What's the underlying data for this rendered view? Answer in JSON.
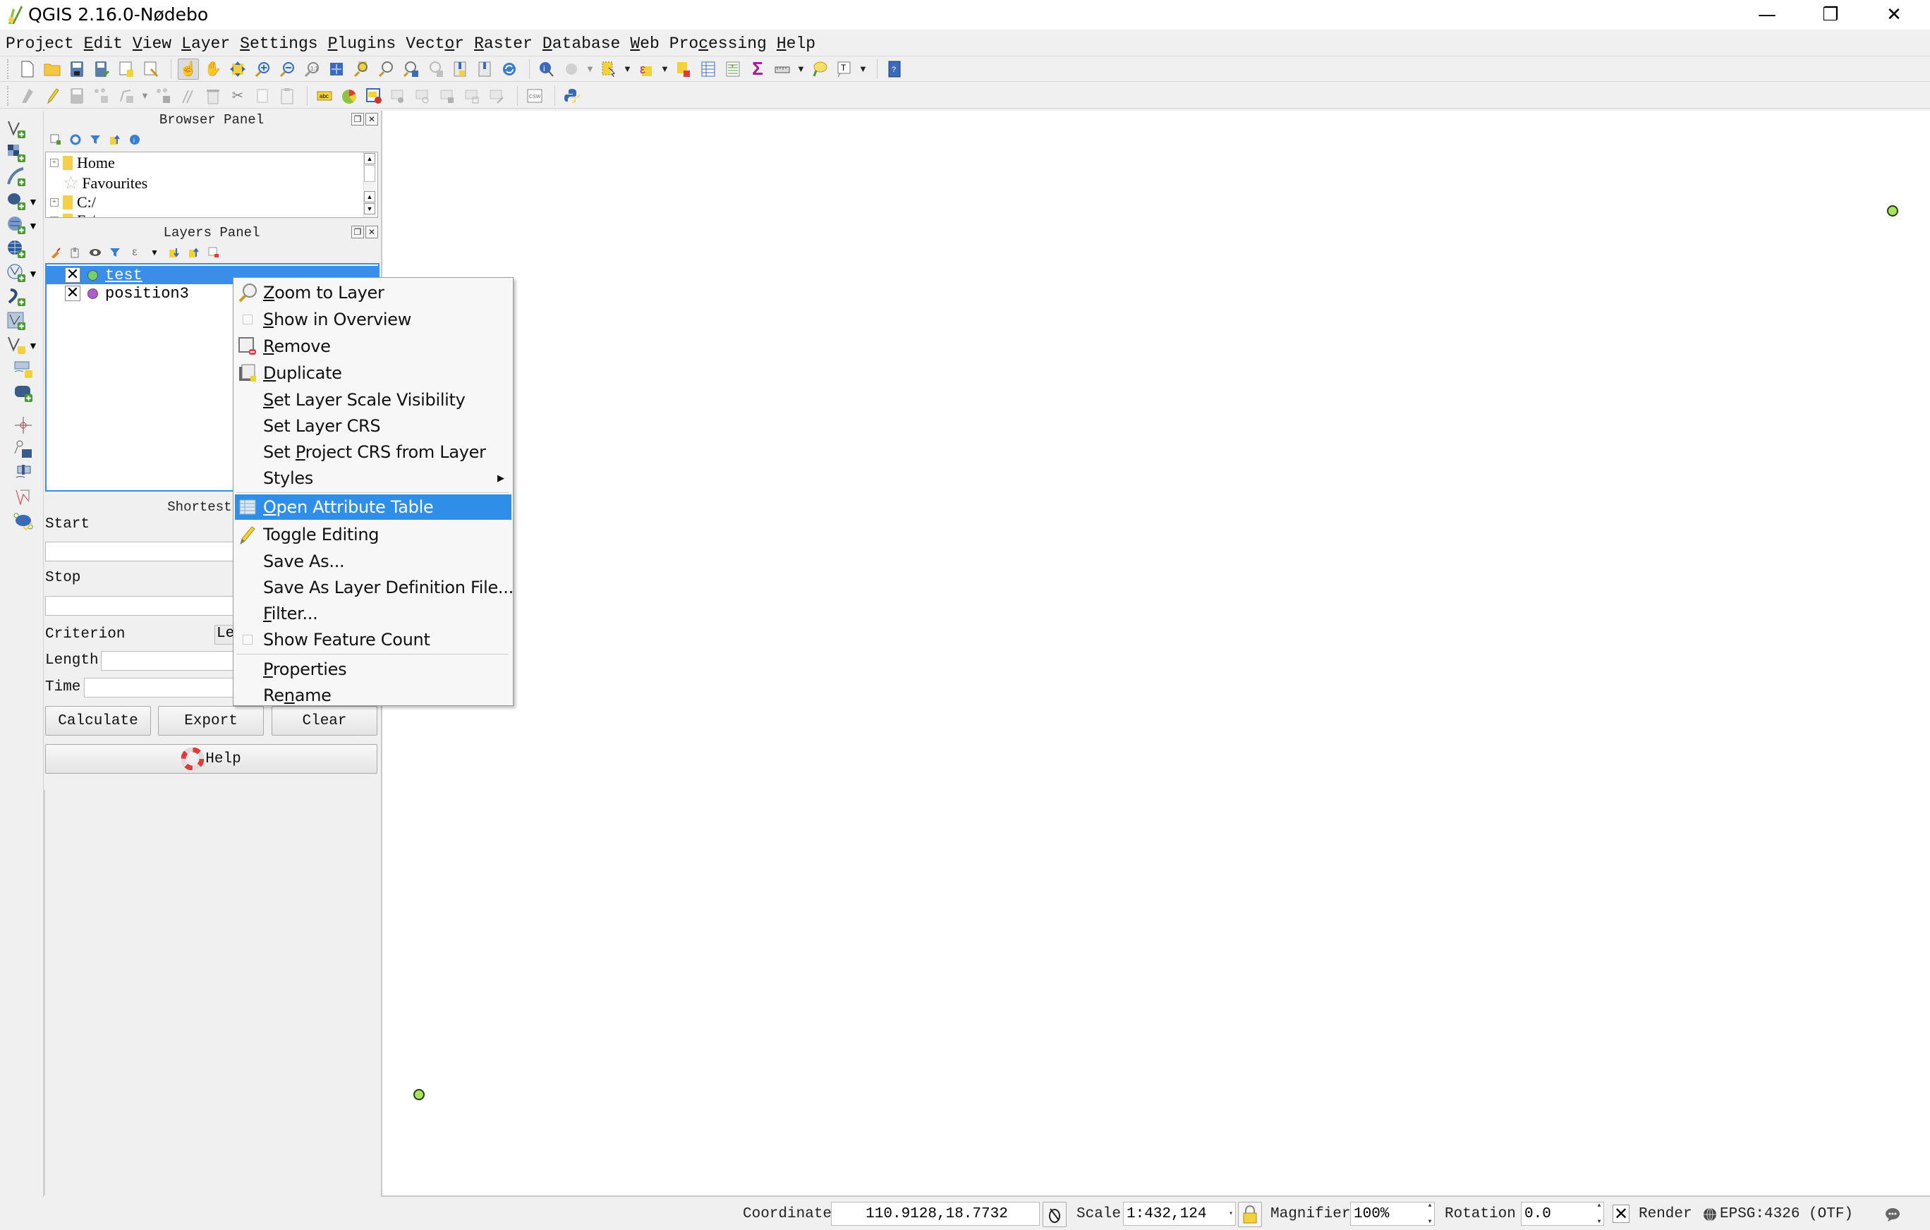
{
  "window": {
    "title": "QGIS 2.16.0-Nødebo",
    "controls": {
      "minimize": "—",
      "maximize": "❐",
      "close": "✕"
    }
  },
  "menubar": {
    "items": [
      "Project",
      "Edit",
      "View",
      "Layer",
      "Settings",
      "Plugins",
      "Vector",
      "Raster",
      "Database",
      "Web",
      "Processing",
      "Help"
    ]
  },
  "toolbar1": {
    "icons": [
      "new-project",
      "open-project",
      "save-project",
      "save-project-as",
      "new-print-composer",
      "composer-manager",
      "touch-zoom-pan",
      "pan-map",
      "pan-to-selection",
      "zoom-in",
      "zoom-out",
      "zoom-native",
      "zoom-full",
      "zoom-to-selection",
      "zoom-to-layer",
      "zoom-last",
      "zoom-next",
      "new-bookmark",
      "show-bookmarks",
      "refresh",
      "identify-features",
      "measure-dropdown",
      "select-features",
      "select-by-expression",
      "deselect-all",
      "open-attribute-table",
      "open-field-calculator",
      "statistical-summary",
      "measure-line",
      "map-tips",
      "text-annotation",
      "help-contents"
    ]
  },
  "toolbar2": {
    "icons": [
      "digitize",
      "toggle-editing",
      "save-edits",
      "add-feature",
      "node-tool",
      "move-feature",
      "delete-selected",
      "cut-features",
      "copy-features",
      "paste-features",
      "layer-labeling",
      "diagram",
      "pin-labels",
      "show-hide-labels",
      "move-label",
      "rotate-label",
      "change-label",
      "csw-search",
      "python-console"
    ]
  },
  "vtoolbar": {
    "icons": [
      "add-vector-layer",
      "add-raster-layer",
      "add-delimited-text-layer",
      "add-postgis-layer",
      "add-spatialite-layer",
      "add-wms-layer",
      "add-wfs-layer",
      "add-oracle-layer",
      "add-virtual-layer",
      "new-shapefile-layer",
      "new-spatialite-layer",
      "new-geopackage-layer",
      "capture-point",
      "digitize-with-segment",
      "gps-tool",
      "road-graph",
      "topology-checker"
    ]
  },
  "browser_panel": {
    "title": "Browser Panel",
    "tree": [
      {
        "label": "Home",
        "type": "folder",
        "expandable": true
      },
      {
        "label": "Favourites",
        "type": "favourites",
        "expandable": false
      },
      {
        "label": "C:/",
        "type": "folder",
        "expandable": true
      },
      {
        "label": "E:/",
        "type": "folder",
        "expandable": true
      }
    ]
  },
  "layers_panel": {
    "title": "Layers Panel",
    "layers": [
      {
        "name": "test",
        "visible": true,
        "symbol_color": "#6fd36a",
        "selected": true
      },
      {
        "name": "position3",
        "visible": true,
        "symbol_color": "#b05bcf",
        "selected": false
      }
    ]
  },
  "shortest_path": {
    "title": "Shortest pa",
    "start_label": "Start",
    "start_value": "",
    "stop_label": "Stop",
    "stop_value": "",
    "criterion_label": "Criterion",
    "criterion_value": "Le",
    "length_label": "Length",
    "length_value": "",
    "time_label": "Time",
    "time_value": "",
    "calculate_label": "Calculate",
    "export_label": "Export",
    "clear_label": "Clear",
    "help_label": "Help"
  },
  "context_menu": {
    "items": [
      {
        "pre": "",
        "key": "Z",
        "post": "oom to Layer",
        "icon": "zoom-to-layer"
      },
      {
        "pre": "",
        "key": "S",
        "post": "how in Overview",
        "icon": "checkbox"
      },
      {
        "pre": "",
        "key": "R",
        "post": "emove",
        "icon": "remove-layer"
      },
      {
        "pre": "",
        "key": "D",
        "post": "uplicate",
        "icon": "duplicate-layer"
      },
      {
        "pre": "",
        "key": "S",
        "post": "et Layer Scale Visibility",
        "icon": ""
      },
      {
        "pre": "Set Layer CRS",
        "key": "",
        "post": "",
        "icon": ""
      },
      {
        "pre": "Set ",
        "key": "P",
        "post": "roject CRS from Layer",
        "icon": ""
      },
      {
        "pre": "Styles",
        "key": "",
        "post": "",
        "icon": "",
        "submenu": true
      },
      {
        "pre": "",
        "key": "O",
        "post": "pen Attribute Table",
        "icon": "attribute-table",
        "highlighted": true
      },
      {
        "pre": "Toggle Editing",
        "key": "",
        "post": "",
        "icon": "pencil"
      },
      {
        "pre": "Save As...",
        "key": "",
        "post": "",
        "icon": ""
      },
      {
        "pre": "Save As Layer Definition File...",
        "key": "",
        "post": "",
        "icon": ""
      },
      {
        "pre": "",
        "key": "F",
        "post": "ilter...",
        "icon": ""
      },
      {
        "pre": "Show Feature Count",
        "key": "",
        "post": "",
        "icon": "checkbox"
      },
      {
        "pre": "",
        "key": "P",
        "post": "roperties",
        "icon": ""
      },
      {
        "pre": "Re",
        "key": "n",
        "post": "ame",
        "icon": ""
      }
    ]
  },
  "map": {
    "points": [
      {
        "layer": "test",
        "color": "#a6e55a"
      },
      {
        "layer": "test",
        "color": "#a6e55a"
      }
    ]
  },
  "statusbar": {
    "coordinate_label": "Coordinate",
    "coordinate_value": "110.9128,18.7732",
    "scale_label": "Scale",
    "scale_value": "1:432,124",
    "magnifier_label": "Magnifier",
    "magnifier_value": "100%",
    "rotation_label": "Rotation",
    "rotation_value": "0.0",
    "render_label": "Render",
    "render_checked": true,
    "crs_label": "EPSG:4326 (OTF)"
  }
}
